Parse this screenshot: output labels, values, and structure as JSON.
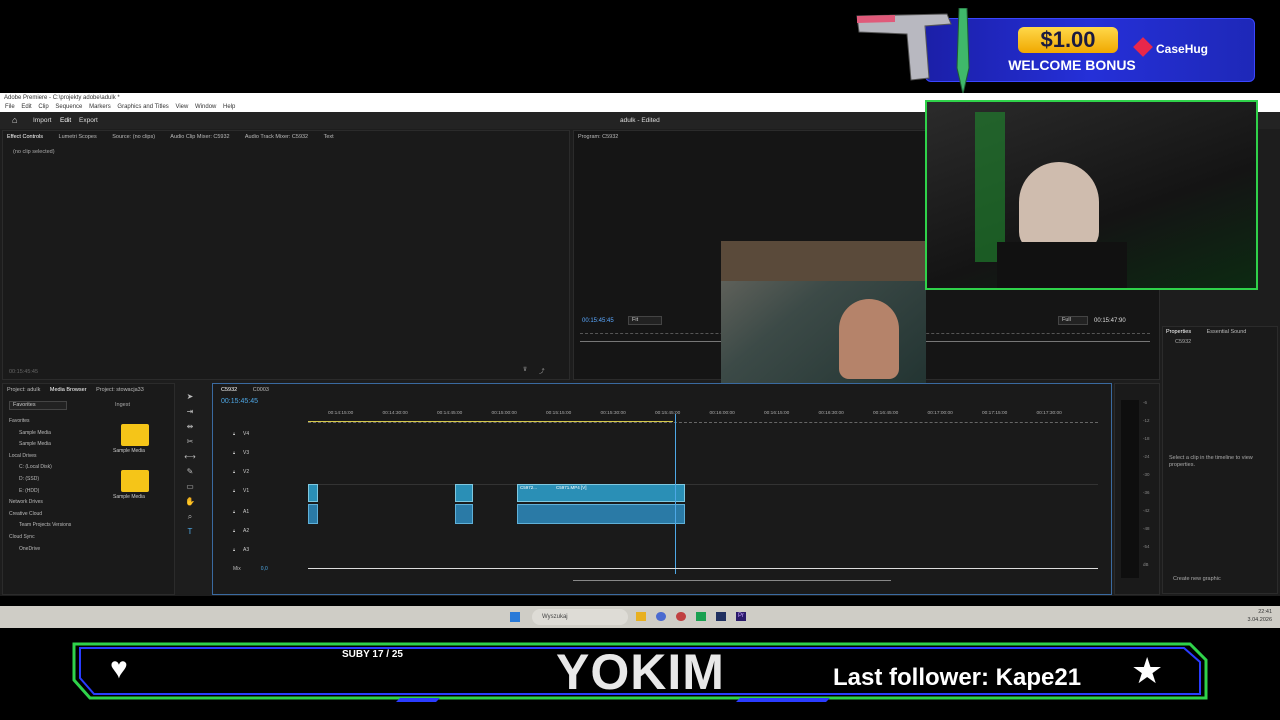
{
  "sponsor": {
    "amount": "$1.00",
    "text": "WELCOME BONUS",
    "brand": "CaseHug"
  },
  "app": {
    "title": "Adobe Premiere - C:\\projekty adobe\\adulk *",
    "menu": [
      "File",
      "Edit",
      "Clip",
      "Sequence",
      "Markers",
      "Graphics and Titles",
      "View",
      "Window",
      "Help"
    ],
    "header": {
      "import": "Import",
      "edit": "Edit",
      "export": "Export",
      "project_name": "adulk - Edited"
    }
  },
  "source_panel": {
    "tabs": [
      "Effect Controls",
      "Lumetri Scopes",
      "Source: (no clips)",
      "Audio Clip Mixer: C5932",
      "Audio Track Mixer: C5932",
      "Text"
    ],
    "no_clip": "(no clip selected)",
    "timecode": "00:15:45:45"
  },
  "program_panel": {
    "tab": "Program: C5932",
    "timecode_left": "00:15:45:45",
    "fit": "Fit",
    "quality": "Full",
    "timecode_right": "00:15:47:90"
  },
  "properties_panel": {
    "tabs": [
      "Properties",
      "Essential Sound"
    ],
    "item": "C5932",
    "hint": "Select a clip in the timeline to view properties.",
    "create_graphic": "Create new graphic"
  },
  "project_panel": {
    "tabs": [
      "Project: adulk",
      "Media Browser",
      "Project: stowacja33"
    ],
    "favorites_dropdown": "Favorites",
    "ingest": "Ingest",
    "tree": [
      "Favorites",
      "Sample Media",
      "Sample Media",
      "Local Drives",
      "C: (Local Disk)",
      "D: (SSD)",
      "E: (HDD)",
      "Network Drives",
      "Creative Cloud",
      "Team Projects Versions",
      "Cloud Sync",
      "OneDrive"
    ],
    "folders": [
      "Sample Media",
      "Sample Media"
    ]
  },
  "timeline": {
    "tabs": [
      "C5932",
      "C0003"
    ],
    "timecode": "00:15:45:45",
    "ruler": [
      "00:14:15:00",
      "00:14:30:00",
      "00:14:45:00",
      "00:15:00:00",
      "00:15:15:00",
      "00:15:30:00",
      "00:15:45:00",
      "00:16:00:00",
      "00:16:15:00",
      "00:16:30:00",
      "00:16:45:00",
      "00:17:00:00",
      "00:17:15:00",
      "00:17:30:00"
    ],
    "tracks": [
      "V4",
      "V3",
      "V2",
      "V1",
      "A1",
      "A2",
      "A3"
    ],
    "mix_label": "Mix",
    "mix_value": "0,0",
    "clip_labels": [
      "C5972...",
      "C5971.MP4 [V]"
    ],
    "meter_labels": [
      "-6",
      "-12",
      "-18",
      "-24",
      "-30",
      "-36",
      "-42",
      "-48",
      "-54",
      "dB"
    ]
  },
  "taskbar": {
    "search": "Wyszukaj",
    "time": "22:41",
    "date": "3.04.2026"
  },
  "overlay": {
    "subs": "SUBY 17 / 25",
    "name": "YOKIM",
    "follower": "Last follower: Kape21"
  },
  "colors": {
    "accent": "#2fd24a",
    "timeline_blue": "#2a8fb6",
    "playhead": "#4ea8e6"
  }
}
